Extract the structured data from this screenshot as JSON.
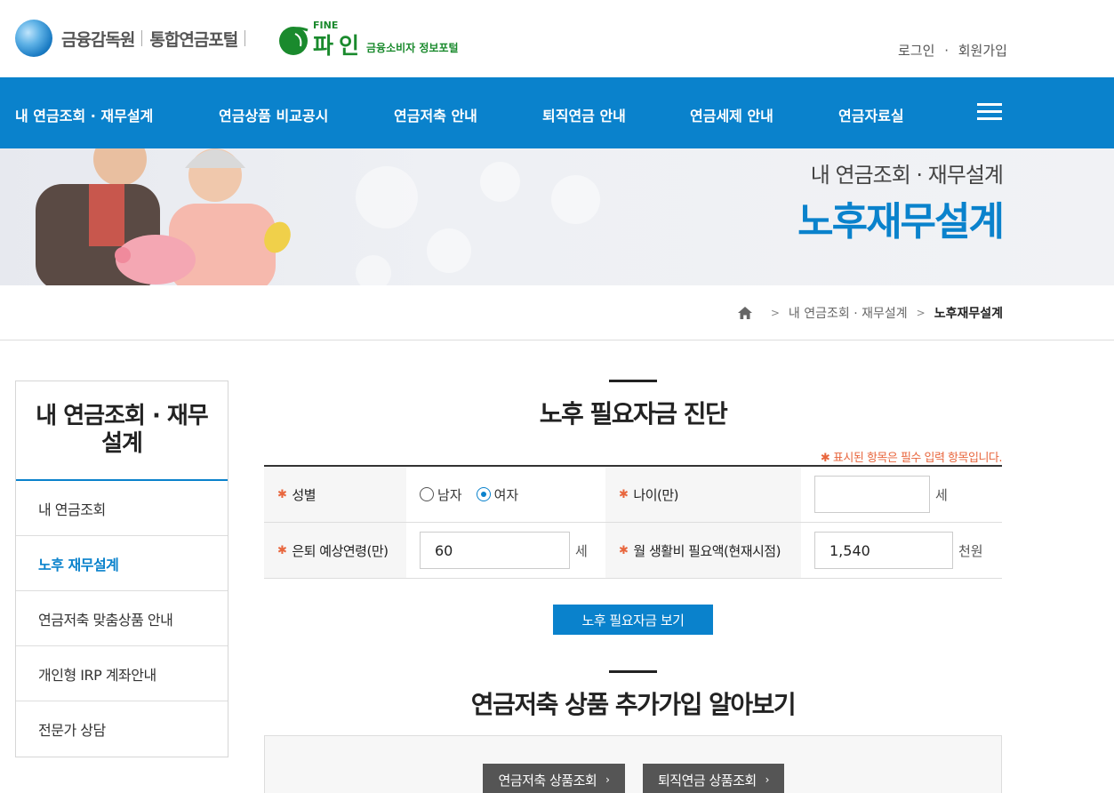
{
  "header": {
    "fss_name": "금융감독원",
    "portal_name": "통합연금포털",
    "fine_label": "FINE",
    "pain_label": "파인",
    "fine_sub": "금융소비자 정보포털",
    "login": "로그인",
    "dot": "·",
    "join": "회원가입"
  },
  "nav": {
    "items": [
      "내 연금조회 · 재무설계",
      "연금상품 비교공시",
      "연금저축 안내",
      "퇴직연금 안내",
      "연금세제 안내",
      "연금자료실"
    ],
    "menu_icon": "hamburger-icon"
  },
  "banner": {
    "subtitle": "내 연금조회 · 재무설계",
    "title": "노후재무설계"
  },
  "breadcrumb": {
    "home_icon": "home-icon",
    "level1": "내 연금조회 · 재무설계",
    "current": "노후재무설계"
  },
  "sidebar": {
    "title": "내 연금조회 · 재무설계",
    "items": [
      "내 연금조회",
      "노후 재무설계",
      "연금저축 맞춤상품 안내",
      "개인형 IRP 계좌안내",
      "전문가 상담"
    ],
    "active_index": 1
  },
  "diagnosis": {
    "title": "노후 필요자금 진단",
    "required_note": "✱ 표시된 항목은 필수 입력 항목입니다.",
    "star": "✱",
    "gender_label": "성별",
    "gender_male": "남자",
    "gender_female": "여자",
    "gender_selected": "여자",
    "age_label": "나이(만)",
    "age_value": "",
    "age_unit": "세",
    "retire_label": "은퇴 예상연령(만)",
    "retire_value": "60",
    "retire_unit": "세",
    "living_label": "월 생활비 필요액(현재시점)",
    "living_value": "1,540",
    "living_unit": "천원",
    "submit": "노후 필요자금 보기"
  },
  "products": {
    "title": "연금저축 상품 추가가입 알아보기",
    "btn_savings": "연금저축 상품조회",
    "btn_retirement": "퇴직연금 상품조회",
    "chevron": "›"
  },
  "colors": {
    "brand_blue": "#0a82cc",
    "fine_green": "#1a8a2d",
    "required_orange": "#e8663d"
  }
}
